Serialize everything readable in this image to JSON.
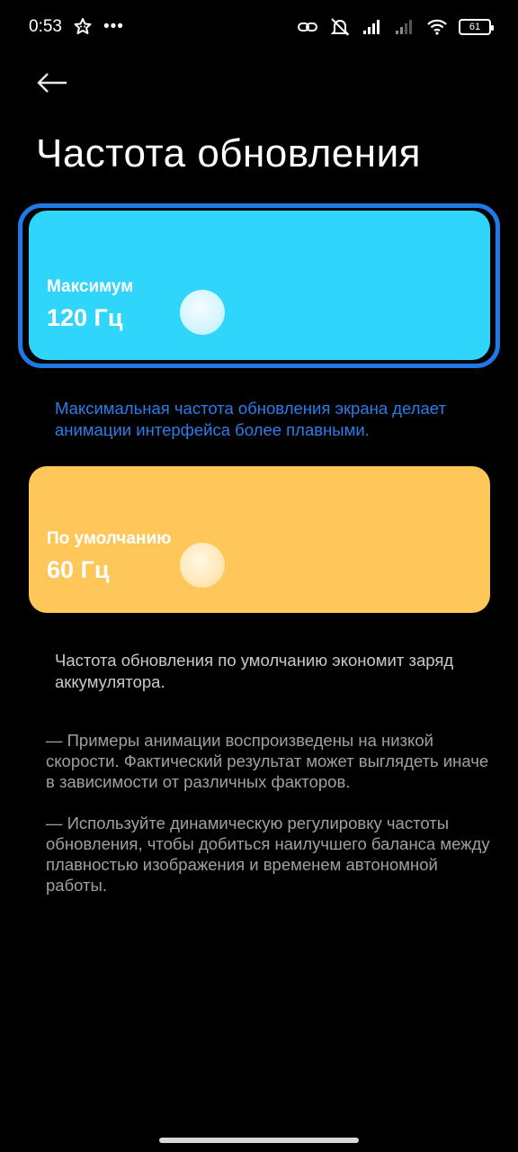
{
  "status_bar": {
    "time": "0:53",
    "more": "•••",
    "battery_level": "61",
    "icons": [
      "star-face-icon",
      "link-icon",
      "alarm-off-icon",
      "signal-icon",
      "signal-weak-icon",
      "wifi-icon",
      "battery-icon"
    ]
  },
  "header": {
    "back_icon": "back-arrow-icon",
    "title": "Частота обновления"
  },
  "options": {
    "max": {
      "label": "Максимум",
      "value": "120 Гц",
      "selected": true,
      "color": "#2fd5fb",
      "description": "Максимальная частота обновления экрана делает анимации интерфейса более плавными."
    },
    "default": {
      "label": "По умолчанию",
      "value": "60 Гц",
      "selected": false,
      "color": "#ffc75a",
      "description": "Частота обновления по умолчанию экономит заряд аккумулятора."
    }
  },
  "notes": {
    "note_1": "— Примеры анимации воспроизведены на низкой скорости. Фактический результат может выглядеть иначе в зависимости от различных факторов.",
    "note_2": "— Используйте динамическую регулировку частоты обновления, чтобы добиться наилучшего баланса между плавностью изображения и временем автономной работы."
  },
  "colors": {
    "background": "#000000",
    "selection_ring": "#1f7ae8",
    "accent_text": "#2b7de8"
  }
}
